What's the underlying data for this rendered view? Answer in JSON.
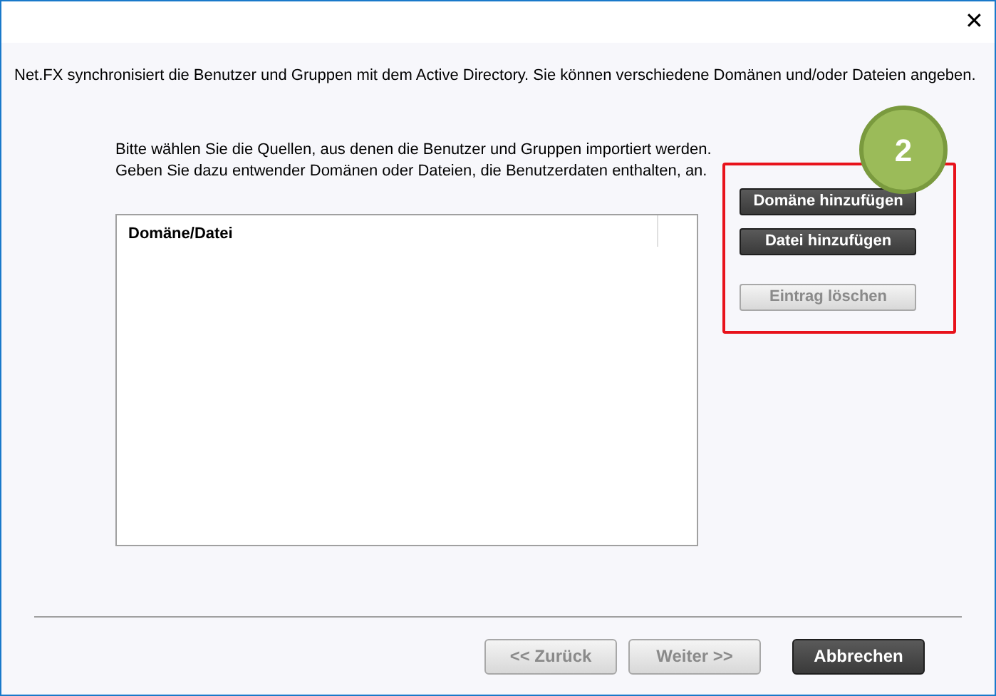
{
  "window": {
    "close": "✕"
  },
  "intro": "Net.FX synchronisiert die Benutzer und Gruppen mit dem Active Directory. Sie können verschiedene Domänen und/oder Dateien angeben.",
  "instructions": [
    "Bitte wählen Sie die Quellen, aus denen die Benutzer und Gruppen importiert werden.",
    "Geben Sie dazu entwender Domänen oder Dateien, die Benutzerdaten enthalten, an."
  ],
  "step_badge": "2",
  "list": {
    "columns": [
      "Domäne/Datei"
    ]
  },
  "side_buttons": [
    {
      "label": "Domäne hinzufügen",
      "disabled": false
    },
    {
      "label": "Datei hinzufügen",
      "disabled": false
    },
    {
      "label": "Eintrag löschen",
      "disabled": true
    }
  ],
  "footer_buttons": [
    {
      "label": "<< Zurück",
      "disabled": true
    },
    {
      "label": "Weiter >>",
      "disabled": true
    },
    {
      "label": "Abbrechen",
      "disabled": false
    }
  ]
}
